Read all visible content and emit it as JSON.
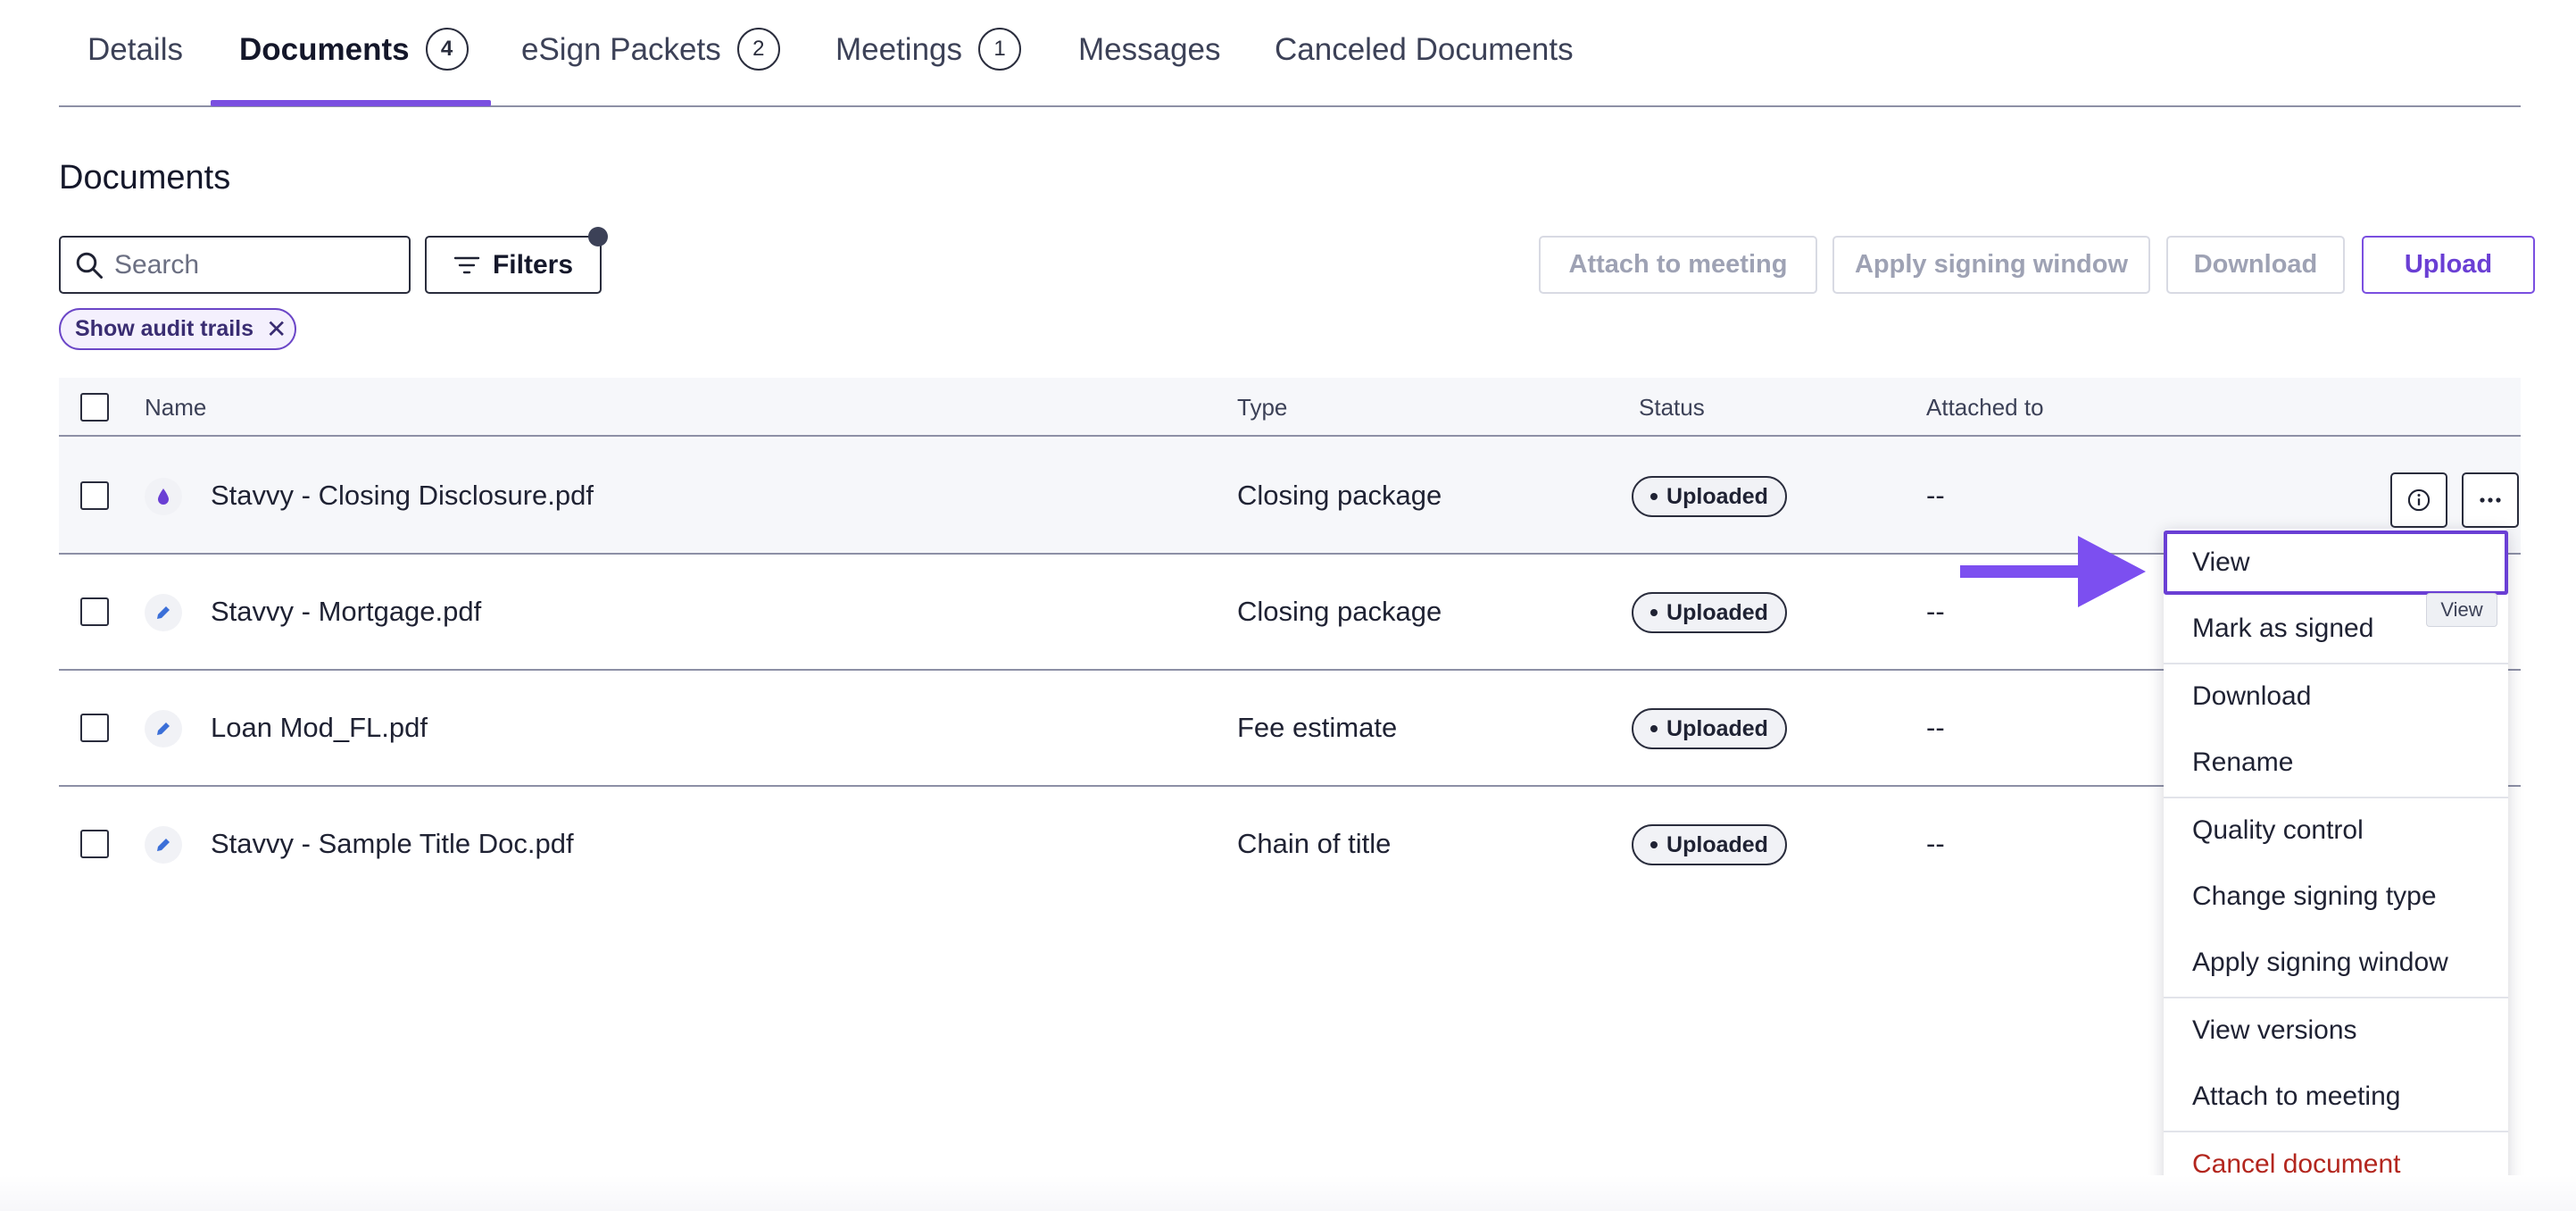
{
  "tabs": [
    {
      "label": "Details",
      "count": null
    },
    {
      "label": "Documents",
      "count": "4"
    },
    {
      "label": "eSign Packets",
      "count": "2"
    },
    {
      "label": "Meetings",
      "count": "1"
    },
    {
      "label": "Messages",
      "count": null
    },
    {
      "label": "Canceled Documents",
      "count": null
    }
  ],
  "page_title": "Documents",
  "toolbar": {
    "search_placeholder": "Search",
    "filters_label": "Filters",
    "attach_label": "Attach to meeting",
    "apply_window_label": "Apply signing window",
    "download_label": "Download",
    "upload_label": "Upload"
  },
  "chip": {
    "label": "Show audit trails",
    "remove": "✕"
  },
  "table": {
    "headers": {
      "name": "Name",
      "type": "Type",
      "status": "Status",
      "attached": "Attached to"
    },
    "rows": [
      {
        "name": "Stavvy - Closing Disclosure.pdf",
        "type": "Closing package",
        "status": "Uploaded",
        "attached": "--",
        "icon": "droplet-icon"
      },
      {
        "name": "Stavvy - Mortgage.pdf",
        "type": "Closing package",
        "status": "Uploaded",
        "attached": "--",
        "icon": "pencil-icon"
      },
      {
        "name": "Loan Mod_FL.pdf",
        "type": "Fee estimate",
        "status": "Uploaded",
        "attached": "--",
        "icon": "pencil-icon"
      },
      {
        "name": "Stavvy - Sample Title Doc.pdf",
        "type": "Chain of title",
        "status": "Uploaded",
        "attached": "--",
        "icon": "pencil-icon"
      }
    ]
  },
  "menu": {
    "items": [
      {
        "label": "View"
      },
      {
        "label": "Mark as signed"
      },
      {
        "label": "Download"
      },
      {
        "label": "Rename"
      },
      {
        "label": "Quality control"
      },
      {
        "label": "Change signing type"
      },
      {
        "label": "Apply signing window"
      },
      {
        "label": "View versions"
      },
      {
        "label": "Attach to meeting"
      },
      {
        "label": "Cancel document"
      }
    ]
  },
  "tooltip": "View",
  "colors": {
    "accent": "#7a4fe0",
    "danger": "#b3261e",
    "arrow": "#7c4ff0"
  }
}
